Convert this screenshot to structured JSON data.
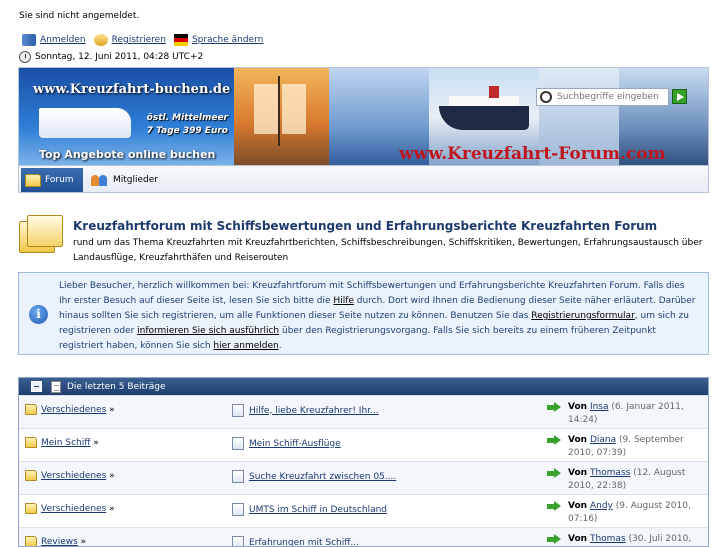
{
  "header": {
    "login_status": "Sie sind nicht angemeldet.",
    "links": {
      "login": "Anmelden",
      "register": "Registrieren",
      "language": "Sprache ändern"
    },
    "datetime": "Sonntag, 12. Juni 2011, 04:28 UTC+2"
  },
  "banner": {
    "logo_text": "www.Kreuzfahrt-buchen.de",
    "promo_line1": "östl. Mittelmeer",
    "promo_line2": "7 Tage 399 Euro",
    "cta": "Top Angebote online buchen",
    "site_name": "www.Kreuzfahrt-Forum.com"
  },
  "search": {
    "placeholder": "Suchbegriffe eingeben"
  },
  "nav": {
    "tabs": [
      {
        "label": "Forum",
        "active": true
      },
      {
        "label": "Mitglieder",
        "active": false
      }
    ]
  },
  "page": {
    "title": "Kreuzfahrtforum mit Schiffsbewertungen und Erfahrungsberichte Kreuzfahrten Forum",
    "description": "rund um das Thema Kreuzfahrten mit Kreuzfahrtberichten, Schiffsbeschreibungen, Schiffskritiken, Bewertungen, Erfahrungsaustausch über Landausflüge, Kreuzfahrthäfen und Reiserouten"
  },
  "info": {
    "t1": "Lieber Besucher, herzlich willkommen bei: Kreuzfahrtforum mit Schiffsbewertungen und Erfahrungsberichte Kreuzfahrten Forum. Falls dies Ihr erster Besuch auf dieser Seite ist, lesen Sie sich bitte die ",
    "help_link": "Hilfe",
    "t2": " durch. Dort wird Ihnen die Bedienung dieser Seite näher erläutert. Darüber hinaus sollten Sie sich registrieren, um alle Funktionen dieser Seite nutzen zu können. Benutzen Sie das ",
    "register_link": "Registrierungsformular",
    "t3": ", um sich zu registrieren oder ",
    "info_link": "informieren Sie sich ausführlich",
    "t4": " über den Registrierungsvorgang. Falls Sie sich bereits zu einem früheren Zeitpunkt registriert haben, können Sie sich ",
    "login_link": "hier anmelden",
    "t5": "."
  },
  "recent_posts": {
    "header": "Die letzten 5 Beiträge",
    "by_prefix": "Von",
    "rows": [
      {
        "board": "Verschiedenes",
        "topic": "Hilfe, liebe Kreuzfahrer! Ihr...",
        "user": "Insa",
        "date": "(6. Januar 2011, 14:24)"
      },
      {
        "board": "Mein Schiff",
        "topic": "Mein Schiff-Ausflüge",
        "user": "Diana",
        "date": "(9. September 2010, 07:39)"
      },
      {
        "board": "Verschiedenes",
        "topic": "Suche Kreuzfahrt zwischen 05....",
        "user": "Thomass",
        "date": "(12. August 2010, 22:38)"
      },
      {
        "board": "Verschiedenes",
        "topic": "UMTS im Schiff in Deutschland",
        "user": "Andy",
        "date": "(9. August 2010, 07:16)"
      },
      {
        "board": "Reviews",
        "topic": "Erfahrungen mit Schiff...",
        "user": "Thomas",
        "date": "(30. Juli 2010,"
      }
    ]
  }
}
